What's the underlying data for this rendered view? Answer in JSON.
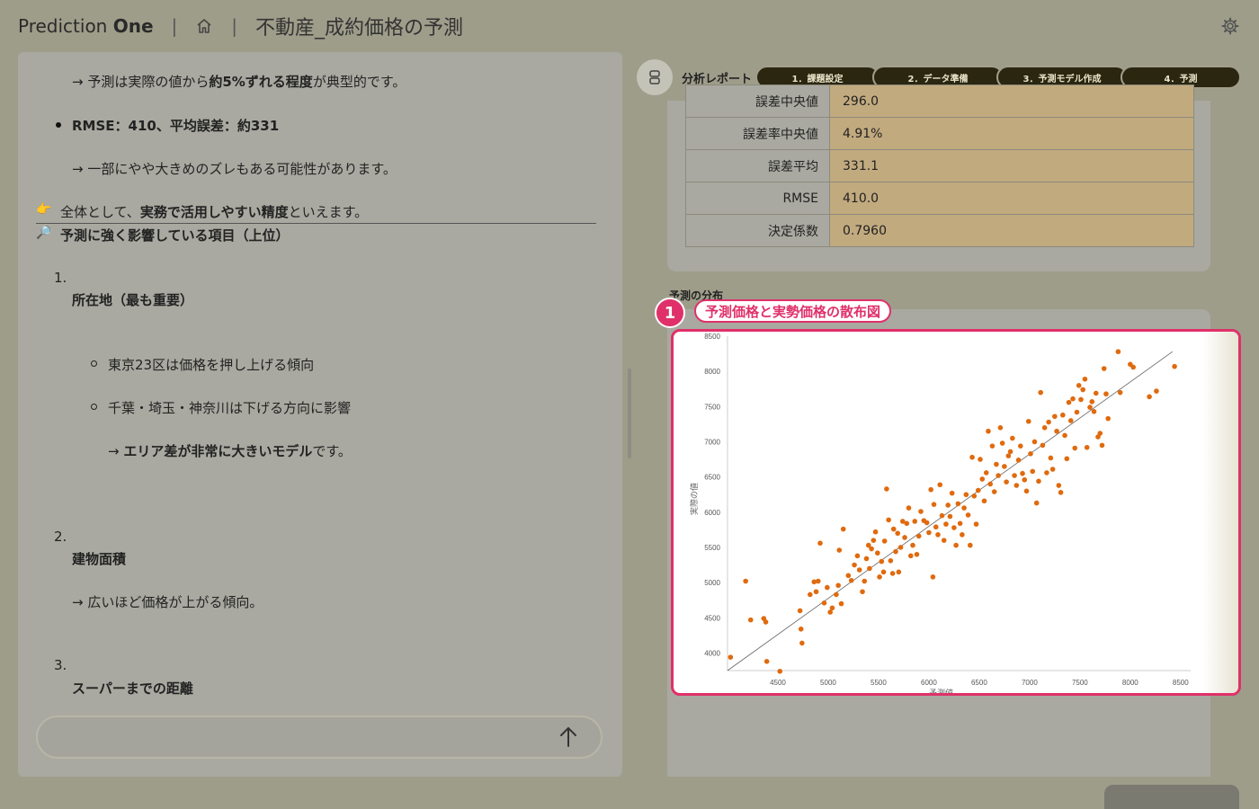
{
  "header": {
    "brand_light": "Prediction ",
    "brand_bold": "One",
    "sep1": "|",
    "sep2": "|",
    "title": "不動産_成約価格の予測"
  },
  "chat": {
    "lines": {
      "l1a": "→ 予測は実際の値から",
      "l1b": "約5%ずれる程度",
      "l1c": "が典型的です。",
      "l2": "RMSE：410、平均誤差：約331",
      "l3": "→ 一部にやや大きめのズレもある可能性があります。",
      "l4_icon": "👉",
      "l4a": "全体として、",
      "l4b": "実務で活用しやすい精度",
      "l4c": "といえます。",
      "l5_icon": "🔎",
      "l5": "予測に強く影響している項目（上位）",
      "n1": "1.",
      "item1": "所在地（最も重要）",
      "sub1": "東京23区は価格を押し上げる傾向",
      "sub2": "千葉・埼玉・神奈川は下げる方向に影響",
      "sub3a": "→ ",
      "sub3b": "エリア差が非常に大きいモデル",
      "sub3c": "です。",
      "n2": "2.",
      "item2": "建物面積",
      "item2_desc": "→ 広いほど価格が上がる傾向。",
      "n3": "3.",
      "item3": "スーパーまでの距離"
    },
    "input_placeholder": ""
  },
  "report": {
    "label": "分析レポート",
    "steps": [
      "1．課題設定",
      "2．データ準備",
      "3．予測モデル作成",
      "4．予測"
    ]
  },
  "metrics": [
    {
      "label": "誤差中央値",
      "value": "296.0"
    },
    {
      "label": "誤差率中央値",
      "value": "4.91%"
    },
    {
      "label": "誤差平均",
      "value": "331.1"
    },
    {
      "label": "RMSE",
      "value": "410.0"
    },
    {
      "label": "決定係数",
      "value": "0.7960"
    }
  ],
  "dist_heading": "予測の分布",
  "callout": {
    "number": "1",
    "label": "予測価格と実勢価格の散布図"
  },
  "chart_data": {
    "type": "scatter",
    "xlabel": "予測値",
    "ylabel": "実際の値",
    "xticks": [
      "4500",
      "5000",
      "5500",
      "6000",
      "6500",
      "7000",
      "7500",
      "8000",
      "8500"
    ],
    "yticks": [
      "4000",
      "4500",
      "5000",
      "5500",
      "6000",
      "6500",
      "7000",
      "7500",
      "8000",
      "8500"
    ],
    "xlim": [
      4000,
      8600
    ],
    "ylim": [
      3750,
      8500
    ],
    "color": "#e06a0e",
    "points": [
      [
        4030,
        3940
      ],
      [
        4180,
        5020
      ],
      [
        4230,
        4470
      ],
      [
        4360,
        4490
      ],
      [
        4380,
        4440
      ],
      [
        4390,
        3880
      ],
      [
        4520,
        3740
      ],
      [
        4720,
        4600
      ],
      [
        4730,
        4340
      ],
      [
        4740,
        4140
      ],
      [
        4820,
        4830
      ],
      [
        4860,
        5010
      ],
      [
        4880,
        4870
      ],
      [
        4900,
        5020
      ],
      [
        4920,
        5560
      ],
      [
        4960,
        4710
      ],
      [
        4990,
        4930
      ],
      [
        5020,
        4580
      ],
      [
        5040,
        4640
      ],
      [
        5080,
        4830
      ],
      [
        5100,
        4960
      ],
      [
        5110,
        5460
      ],
      [
        5130,
        4700
      ],
      [
        5150,
        5760
      ],
      [
        5200,
        5100
      ],
      [
        5230,
        5030
      ],
      [
        5260,
        5250
      ],
      [
        5290,
        5380
      ],
      [
        5310,
        5180
      ],
      [
        5340,
        4870
      ],
      [
        5360,
        5020
      ],
      [
        5380,
        5340
      ],
      [
        5400,
        5530
      ],
      [
        5410,
        5200
      ],
      [
        5430,
        5480
      ],
      [
        5450,
        5600
      ],
      [
        5470,
        5720
      ],
      [
        5490,
        5420
      ],
      [
        5510,
        5080
      ],
      [
        5530,
        5300
      ],
      [
        5550,
        5150
      ],
      [
        5560,
        5590
      ],
      [
        5580,
        6330
      ],
      [
        5600,
        5890
      ],
      [
        5620,
        5310
      ],
      [
        5640,
        5130
      ],
      [
        5650,
        5760
      ],
      [
        5670,
        5440
      ],
      [
        5690,
        5700
      ],
      [
        5700,
        5150
      ],
      [
        5720,
        5500
      ],
      [
        5740,
        5870
      ],
      [
        5760,
        5640
      ],
      [
        5780,
        5840
      ],
      [
        5800,
        6060
      ],
      [
        5820,
        5380
      ],
      [
        5840,
        5530
      ],
      [
        5860,
        5870
      ],
      [
        5880,
        5400
      ],
      [
        5900,
        5660
      ],
      [
        5920,
        6010
      ],
      [
        5950,
        5880
      ],
      [
        5980,
        5850
      ],
      [
        6000,
        5710
      ],
      [
        6020,
        6320
      ],
      [
        6040,
        5080
      ],
      [
        6050,
        6110
      ],
      [
        6070,
        5790
      ],
      [
        6090,
        5680
      ],
      [
        6110,
        6390
      ],
      [
        6130,
        5950
      ],
      [
        6150,
        5600
      ],
      [
        6170,
        5830
      ],
      [
        6190,
        6100
      ],
      [
        6210,
        5940
      ],
      [
        6230,
        6270
      ],
      [
        6250,
        5780
      ],
      [
        6270,
        5530
      ],
      [
        6290,
        6120
      ],
      [
        6310,
        5840
      ],
      [
        6330,
        5680
      ],
      [
        6350,
        6060
      ],
      [
        6370,
        6250
      ],
      [
        6390,
        5960
      ],
      [
        6410,
        5530
      ],
      [
        6430,
        6780
      ],
      [
        6450,
        6230
      ],
      [
        6470,
        5830
      ],
      [
        6490,
        6310
      ],
      [
        6510,
        6750
      ],
      [
        6530,
        6470
      ],
      [
        6550,
        6160
      ],
      [
        6570,
        6560
      ],
      [
        6590,
        7150
      ],
      [
        6610,
        6400
      ],
      [
        6630,
        6940
      ],
      [
        6650,
        6290
      ],
      [
        6670,
        6680
      ],
      [
        6690,
        6520
      ],
      [
        6710,
        7200
      ],
      [
        6730,
        6980
      ],
      [
        6750,
        6650
      ],
      [
        6770,
        6430
      ],
      [
        6790,
        6800
      ],
      [
        6810,
        6860
      ],
      [
        6830,
        7050
      ],
      [
        6850,
        6520
      ],
      [
        6870,
        6380
      ],
      [
        6890,
        6740
      ],
      [
        6910,
        6940
      ],
      [
        6930,
        6550
      ],
      [
        6950,
        6460
      ],
      [
        6970,
        6300
      ],
      [
        6990,
        7290
      ],
      [
        7010,
        6830
      ],
      [
        7030,
        6580
      ],
      [
        7050,
        7000
      ],
      [
        7070,
        6130
      ],
      [
        7090,
        6440
      ],
      [
        7110,
        7700
      ],
      [
        7130,
        6950
      ],
      [
        7150,
        7200
      ],
      [
        7170,
        6560
      ],
      [
        7190,
        7280
      ],
      [
        7210,
        6770
      ],
      [
        7230,
        6610
      ],
      [
        7250,
        7360
      ],
      [
        7270,
        7150
      ],
      [
        7290,
        6380
      ],
      [
        7310,
        6280
      ],
      [
        7330,
        7380
      ],
      [
        7350,
        7090
      ],
      [
        7370,
        6760
      ],
      [
        7390,
        7560
      ],
      [
        7410,
        7300
      ],
      [
        7430,
        7610
      ],
      [
        7450,
        6910
      ],
      [
        7470,
        7420
      ],
      [
        7490,
        7800
      ],
      [
        7510,
        7600
      ],
      [
        7530,
        7740
      ],
      [
        7550,
        7890
      ],
      [
        7570,
        6920
      ],
      [
        7600,
        7490
      ],
      [
        7620,
        7570
      ],
      [
        7640,
        7430
      ],
      [
        7660,
        7690
      ],
      [
        7680,
        7070
      ],
      [
        7700,
        7120
      ],
      [
        7720,
        6950
      ],
      [
        7740,
        8040
      ],
      [
        7760,
        7680
      ],
      [
        7780,
        7330
      ],
      [
        7880,
        8280
      ],
      [
        7900,
        7700
      ],
      [
        8000,
        8100
      ],
      [
        8030,
        8060
      ],
      [
        8190,
        7640
      ],
      [
        8260,
        7720
      ],
      [
        8440,
        8070
      ]
    ]
  }
}
